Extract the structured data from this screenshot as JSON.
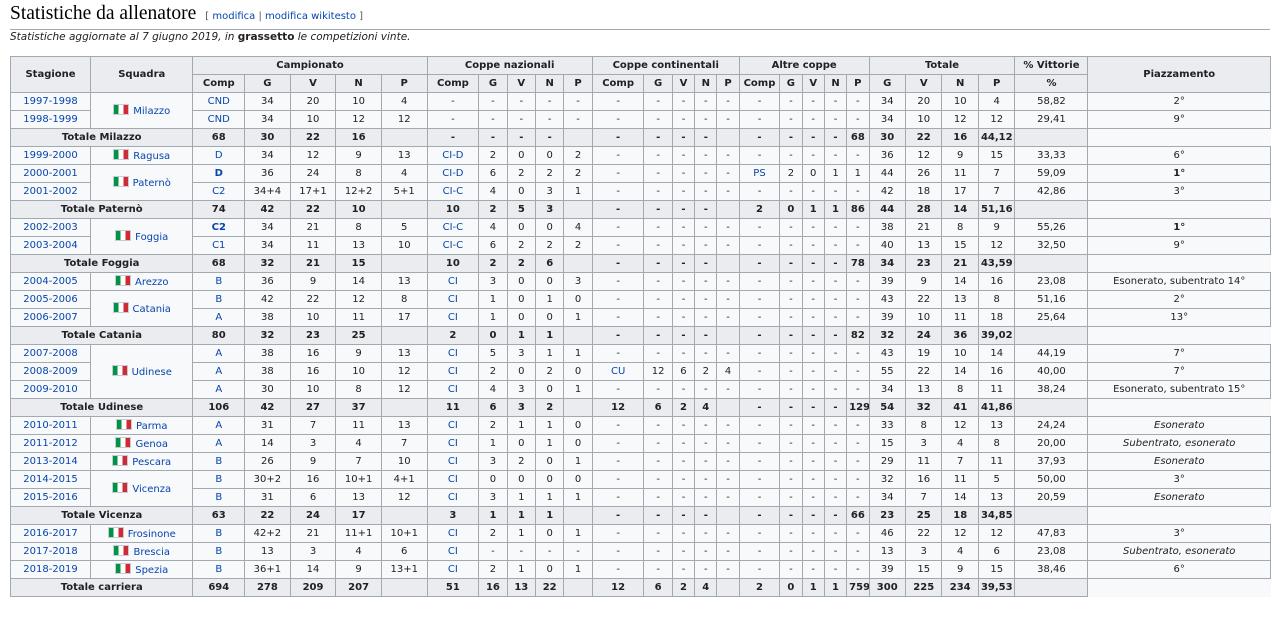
{
  "section": {
    "title": "Statistiche da allenatore",
    "edit_open": "[",
    "edit_link": "modifica",
    "edit_sep": "|",
    "edit_wikitext_link": "modifica wikitesto",
    "edit_close": "]"
  },
  "note": {
    "before": "Statistiche aggiornate al 7 giugno 2019, in ",
    "bold": "grassetto",
    "after": " le competizioni vinte."
  },
  "headers": {
    "group": [
      "Stagione",
      "Squadra",
      "Campionato",
      "Coppe nazionali",
      "Coppe continentali",
      "Altre coppe",
      "Totale",
      "% Vittorie",
      "Piazzamento"
    ],
    "sub": [
      "Comp",
      "G",
      "V",
      "N",
      "P",
      "Comp",
      "G",
      "V",
      "N",
      "P",
      "Comp",
      "G",
      "V",
      "N",
      "P",
      "Comp",
      "G",
      "V",
      "N",
      "P",
      "G",
      "V",
      "N",
      "P",
      "%"
    ]
  },
  "rows": [
    {
      "type": "season",
      "stagione": "1997-1998",
      "team": "Milazzo",
      "team_rows": 2,
      "c": [
        "CND",
        "34",
        "20",
        "10",
        "4",
        "-",
        "-",
        "-",
        "-",
        "-",
        "-",
        "-",
        "-",
        "-",
        "-",
        "-",
        "-",
        "-",
        "-",
        "-",
        "34",
        "20",
        "10",
        "4",
        "58,82"
      ],
      "piaz": "2°"
    },
    {
      "type": "season",
      "stagione": "1998-1999",
      "c": [
        "CND",
        "34",
        "10",
        "12",
        "12",
        "-",
        "-",
        "-",
        "-",
        "-",
        "-",
        "-",
        "-",
        "-",
        "-",
        "-",
        "-",
        "-",
        "-",
        "-",
        "34",
        "10",
        "12",
        "12",
        "29,41"
      ],
      "piaz": "9°"
    },
    {
      "type": "total",
      "label": "Totale Milazzo",
      "c": [
        "68",
        "30",
        "22",
        "16",
        "",
        "-",
        "-",
        "-",
        "-",
        "",
        "-",
        "-",
        "-",
        "-",
        "",
        "-",
        "-",
        "-",
        "-",
        "68",
        "30",
        "22",
        "16",
        "44,12"
      ],
      "piaz": ""
    },
    {
      "type": "season",
      "stagione": "1999-2000",
      "team": "Ragusa",
      "team_rows": 1,
      "c": [
        "D",
        "34",
        "12",
        "9",
        "13",
        "CI-D",
        "2",
        "0",
        "0",
        "2",
        "-",
        "-",
        "-",
        "-",
        "-",
        "-",
        "-",
        "-",
        "-",
        "-",
        "36",
        "12",
        "9",
        "15",
        "33,33"
      ],
      "piaz": "6°"
    },
    {
      "type": "season",
      "stagione": "2000-2001",
      "team": "Paternò",
      "team_rows": 2,
      "c": [
        "D",
        "36",
        "24",
        "8",
        "4",
        "CI-D",
        "6",
        "2",
        "2",
        "2",
        "-",
        "-",
        "-",
        "-",
        "-",
        "PS",
        "2",
        "0",
        "1",
        "1",
        "44",
        "26",
        "11",
        "7",
        "59,09"
      ],
      "piaz": "1°",
      "won": [
        0
      ],
      "piaz_bold": true
    },
    {
      "type": "season",
      "stagione": "2001-2002",
      "c": [
        "C2",
        "34+4",
        "17+1",
        "12+2",
        "5+1",
        "CI-C",
        "4",
        "0",
        "3",
        "1",
        "-",
        "-",
        "-",
        "-",
        "-",
        "-",
        "-",
        "-",
        "-",
        "-",
        "42",
        "18",
        "17",
        "7",
        "42,86"
      ],
      "piaz": "3°"
    },
    {
      "type": "total",
      "label": "Totale Paternò",
      "c": [
        "74",
        "42",
        "22",
        "10",
        "",
        "10",
        "2",
        "5",
        "3",
        "",
        "-",
        "-",
        "-",
        "-",
        "",
        "2",
        "0",
        "1",
        "1",
        "86",
        "44",
        "28",
        "14",
        "51,16"
      ],
      "piaz": ""
    },
    {
      "type": "season",
      "stagione": "2002-2003",
      "team": "Foggia",
      "team_rows": 2,
      "c": [
        "C2",
        "34",
        "21",
        "8",
        "5",
        "CI-C",
        "4",
        "0",
        "0",
        "4",
        "-",
        "-",
        "-",
        "-",
        "-",
        "-",
        "-",
        "-",
        "-",
        "-",
        "38",
        "21",
        "8",
        "9",
        "55,26"
      ],
      "piaz": "1°",
      "won": [
        0
      ],
      "piaz_bold": true
    },
    {
      "type": "season",
      "stagione": "2003-2004",
      "c": [
        "C1",
        "34",
        "11",
        "13",
        "10",
        "CI-C",
        "6",
        "2",
        "2",
        "2",
        "-",
        "-",
        "-",
        "-",
        "-",
        "-",
        "-",
        "-",
        "-",
        "-",
        "40",
        "13",
        "15",
        "12",
        "32,50"
      ],
      "piaz": "9°"
    },
    {
      "type": "total",
      "label": "Totale Foggia",
      "c": [
        "68",
        "32",
        "21",
        "15",
        "",
        "10",
        "2",
        "2",
        "6",
        "",
        "-",
        "-",
        "-",
        "-",
        "",
        "-",
        "-",
        "-",
        "-",
        "78",
        "34",
        "23",
        "21",
        "43,59"
      ],
      "piaz": ""
    },
    {
      "type": "season",
      "stagione": "2004-2005",
      "team": "Arezzo",
      "team_rows": 1,
      "c": [
        "B",
        "36",
        "9",
        "14",
        "13",
        "CI",
        "3",
        "0",
        "0",
        "3",
        "-",
        "-",
        "-",
        "-",
        "-",
        "-",
        "-",
        "-",
        "-",
        "-",
        "39",
        "9",
        "14",
        "16",
        "23,08"
      ],
      "piaz": "Esonerato, subentrato 14°"
    },
    {
      "type": "season",
      "stagione": "2005-2006",
      "team": "Catania",
      "team_rows": 2,
      "c": [
        "B",
        "42",
        "22",
        "12",
        "8",
        "CI",
        "1",
        "0",
        "1",
        "0",
        "-",
        "-",
        "-",
        "-",
        "-",
        "-",
        "-",
        "-",
        "-",
        "-",
        "43",
        "22",
        "13",
        "8",
        "51,16"
      ],
      "piaz": "2°"
    },
    {
      "type": "season",
      "stagione": "2006-2007",
      "c": [
        "A",
        "38",
        "10",
        "11",
        "17",
        "CI",
        "1",
        "0",
        "0",
        "1",
        "-",
        "-",
        "-",
        "-",
        "-",
        "-",
        "-",
        "-",
        "-",
        "-",
        "39",
        "10",
        "11",
        "18",
        "25,64"
      ],
      "piaz": "13°"
    },
    {
      "type": "total",
      "label": "Totale Catania",
      "c": [
        "80",
        "32",
        "23",
        "25",
        "",
        "2",
        "0",
        "1",
        "1",
        "",
        "-",
        "-",
        "-",
        "-",
        "",
        "-",
        "-",
        "-",
        "-",
        "82",
        "32",
        "24",
        "36",
        "39,02"
      ],
      "piaz": ""
    },
    {
      "type": "season",
      "stagione": "2007-2008",
      "team": "Udinese",
      "team_rows": 3,
      "c": [
        "A",
        "38",
        "16",
        "9",
        "13",
        "CI",
        "5",
        "3",
        "1",
        "1",
        "-",
        "-",
        "-",
        "-",
        "-",
        "-",
        "-",
        "-",
        "-",
        "-",
        "43",
        "19",
        "10",
        "14",
        "44,19"
      ],
      "piaz": "7°"
    },
    {
      "type": "season",
      "stagione": "2008-2009",
      "c": [
        "A",
        "38",
        "16",
        "10",
        "12",
        "CI",
        "2",
        "0",
        "2",
        "0",
        "CU",
        "12",
        "6",
        "2",
        "4",
        "-",
        "-",
        "-",
        "-",
        "-",
        "55",
        "22",
        "14",
        "16",
        "40,00"
      ],
      "piaz": "7°"
    },
    {
      "type": "season",
      "stagione": "2009-2010",
      "c": [
        "A",
        "30",
        "10",
        "8",
        "12",
        "CI",
        "4",
        "3",
        "0",
        "1",
        "-",
        "-",
        "-",
        "-",
        "-",
        "-",
        "-",
        "-",
        "-",
        "-",
        "34",
        "13",
        "8",
        "11",
        "38,24"
      ],
      "piaz": "Esonerato, subentrato 15°"
    },
    {
      "type": "total",
      "label": "Totale Udinese",
      "c": [
        "106",
        "42",
        "27",
        "37",
        "",
        "11",
        "6",
        "3",
        "2",
        "",
        "12",
        "6",
        "2",
        "4",
        "",
        "-",
        "-",
        "-",
        "-",
        "129",
        "54",
        "32",
        "41",
        "41,86"
      ],
      "piaz": ""
    },
    {
      "type": "season",
      "stagione": "2010-2011",
      "team": "Parma",
      "team_rows": 1,
      "c": [
        "A",
        "31",
        "7",
        "11",
        "13",
        "CI",
        "2",
        "1",
        "1",
        "0",
        "-",
        "-",
        "-",
        "-",
        "-",
        "-",
        "-",
        "-",
        "-",
        "-",
        "33",
        "8",
        "12",
        "13",
        "24,24"
      ],
      "piaz": "Esonerato",
      "piaz_italic": true
    },
    {
      "type": "season",
      "stagione": "2011-2012",
      "team": "Genoa",
      "team_rows": 1,
      "c": [
        "A",
        "14",
        "3",
        "4",
        "7",
        "CI",
        "1",
        "0",
        "1",
        "0",
        "-",
        "-",
        "-",
        "-",
        "-",
        "-",
        "-",
        "-",
        "-",
        "-",
        "15",
        "3",
        "4",
        "8",
        "20,00"
      ],
      "piaz": "Subentrato, esonerato",
      "piaz_italic": true
    },
    {
      "type": "season",
      "stagione": "2013-2014",
      "team": "Pescara",
      "team_rows": 1,
      "c": [
        "B",
        "26",
        "9",
        "7",
        "10",
        "CI",
        "3",
        "2",
        "0",
        "1",
        "-",
        "-",
        "-",
        "-",
        "-",
        "-",
        "-",
        "-",
        "-",
        "-",
        "29",
        "11",
        "7",
        "11",
        "37,93"
      ],
      "piaz": "Esonerato",
      "piaz_italic": true
    },
    {
      "type": "season",
      "stagione": "2014-2015",
      "team": "Vicenza",
      "team_rows": 2,
      "c": [
        "B",
        "30+2",
        "16",
        "10+1",
        "4+1",
        "CI",
        "0",
        "0",
        "0",
        "0",
        "-",
        "-",
        "-",
        "-",
        "-",
        "-",
        "-",
        "-",
        "-",
        "-",
        "32",
        "16",
        "11",
        "5",
        "50,00"
      ],
      "piaz": "3°"
    },
    {
      "type": "season",
      "stagione": "2015-2016",
      "c": [
        "B",
        "31",
        "6",
        "13",
        "12",
        "CI",
        "3",
        "1",
        "1",
        "1",
        "-",
        "-",
        "-",
        "-",
        "-",
        "-",
        "-",
        "-",
        "-",
        "-",
        "34",
        "7",
        "14",
        "13",
        "20,59"
      ],
      "piaz": "Esonerato",
      "piaz_italic": true
    },
    {
      "type": "total",
      "label": "Totale Vicenza",
      "c": [
        "63",
        "22",
        "24",
        "17",
        "",
        "3",
        "1",
        "1",
        "1",
        "",
        "-",
        "-",
        "-",
        "-",
        "",
        "-",
        "-",
        "-",
        "-",
        "66",
        "23",
        "25",
        "18",
        "34,85"
      ],
      "piaz": ""
    },
    {
      "type": "season",
      "stagione": "2016-2017",
      "team": "Frosinone",
      "team_rows": 1,
      "c": [
        "B",
        "42+2",
        "21",
        "11+1",
        "10+1",
        "CI",
        "2",
        "1",
        "0",
        "1",
        "-",
        "-",
        "-",
        "-",
        "-",
        "-",
        "-",
        "-",
        "-",
        "-",
        "46",
        "22",
        "12",
        "12",
        "47,83"
      ],
      "piaz": "3°"
    },
    {
      "type": "season",
      "stagione": "2017-2018",
      "team": "Brescia",
      "team_rows": 1,
      "c": [
        "B",
        "13",
        "3",
        "4",
        "6",
        "CI",
        "-",
        "-",
        "-",
        "-",
        "-",
        "-",
        "-",
        "-",
        "-",
        "-",
        "-",
        "-",
        "-",
        "-",
        "13",
        "3",
        "4",
        "6",
        "23,08"
      ],
      "piaz": "Subentrato, esonerato",
      "piaz_italic": true
    },
    {
      "type": "season",
      "stagione": "2018-2019",
      "team": "Spezia",
      "team_rows": 1,
      "c": [
        "B",
        "36+1",
        "14",
        "9",
        "13+1",
        "CI",
        "2",
        "1",
        "0",
        "1",
        "-",
        "-",
        "-",
        "-",
        "-",
        "-",
        "-",
        "-",
        "-",
        "-",
        "39",
        "15",
        "9",
        "15",
        "38,46"
      ],
      "piaz": "6°"
    },
    {
      "type": "total",
      "label": "Totale carriera",
      "c": [
        "694",
        "278",
        "209",
        "207",
        "",
        "51",
        "16",
        "13",
        "22",
        "",
        "12",
        "6",
        "2",
        "4",
        "",
        "2",
        "0",
        "1",
        "1",
        "759",
        "300",
        "225",
        "234",
        "39,53"
      ],
      "piaz": ""
    }
  ]
}
